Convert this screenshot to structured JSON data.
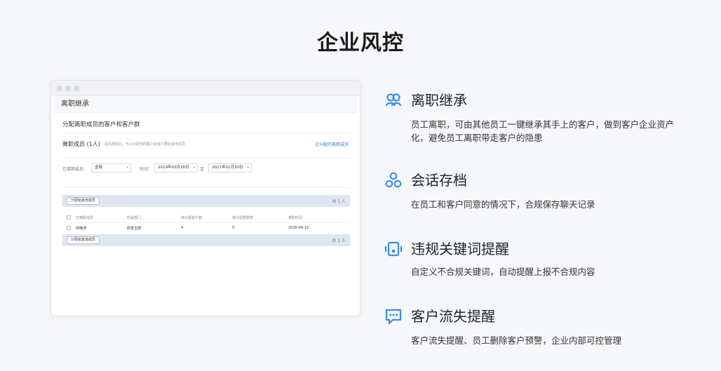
{
  "page": {
    "title": "企业风控"
  },
  "mock": {
    "header": "离职继承",
    "subtitle": "分配离职成员的客户和客户群",
    "leaver_label": "离职成员 (1人)",
    "leaver_tip": "成员离职后，可以分配他的客户和客户群给其他成员",
    "assigned_link": "已分配的离职成员",
    "filter": {
      "member_label": "已离职成员：",
      "member_value": "全部",
      "time_label": "时间：",
      "date_from": "2019年03月28日",
      "to_label": "至",
      "date_to": "2021年01月30日"
    },
    "assign_button": "分配给其他成员",
    "count_text": "共 1 人",
    "table": {
      "headers": [
        "已离职成员",
        "所属部门",
        "待分配客户数",
        "待分配群聊数",
        "离职时间",
        "⋮"
      ],
      "rows": [
        {
          "name": "林楠涛",
          "dept": "研发五部",
          "customers": "4",
          "groups": "0",
          "date": "2020-09-13"
        }
      ]
    }
  },
  "features": [
    {
      "icon": "users-icon",
      "title": "离职继承",
      "desc": "员工离职，可由其他员工一键继承其手上的客户，做到客户企业资产化，避免员工离职带走客户的隐患"
    },
    {
      "icon": "archive-circles-icon",
      "title": "会话存档",
      "desc": "在员工和客户同意的情况下，合规保存聊天记录"
    },
    {
      "icon": "alert-device-icon",
      "title": "违规关键词提醒",
      "desc": "自定义不合规关键词，自动提醒上报不合规内容"
    },
    {
      "icon": "chat-bubble-icon",
      "title": "客户流失提醒",
      "desc": "客户流失提醒、员工删除客户预警，企业内部可控管理"
    }
  ],
  "colors": {
    "accent": "#3a8ee6",
    "background": "#f6f7fa"
  }
}
